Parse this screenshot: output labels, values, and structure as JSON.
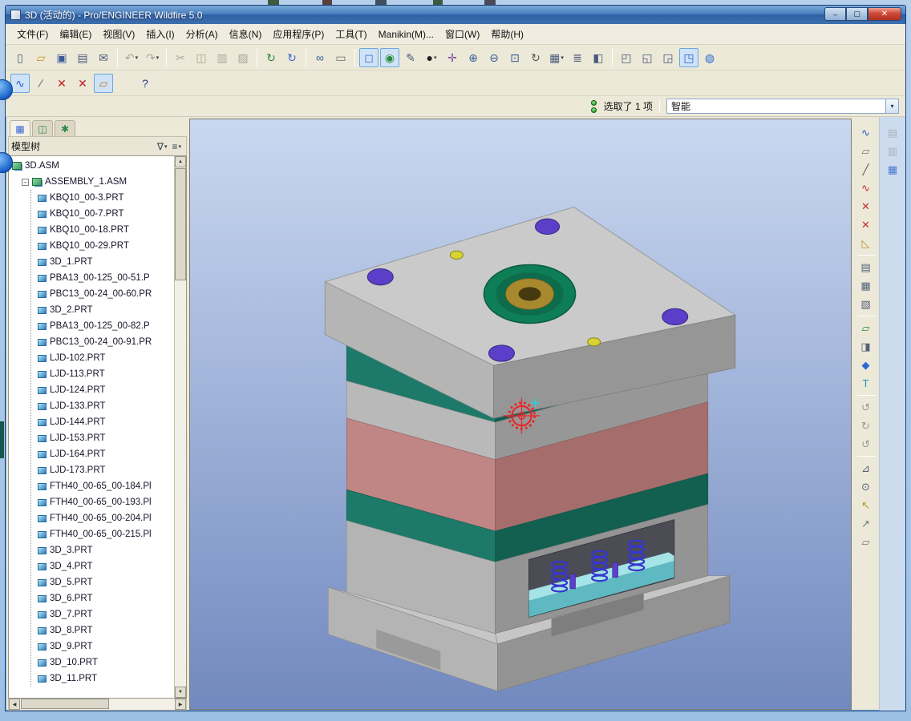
{
  "window": {
    "title": "3D (活动的) - Pro/ENGINEER Wildfire 5.0",
    "controls": {
      "minimize": "–",
      "maximize": "▢",
      "close": "✕"
    }
  },
  "menu": {
    "items": [
      "文件(F)",
      "编辑(E)",
      "视图(V)",
      "插入(I)",
      "分析(A)",
      "信息(N)",
      "应用程序(P)",
      "工具(T)",
      "Manikin(M)...",
      "窗口(W)",
      "帮助(H)"
    ]
  },
  "toolbar_main": {
    "items": [
      {
        "name": "new-file-icon",
        "glyph": "▯",
        "color": "#4a5a7a"
      },
      {
        "name": "open-folder-icon",
        "glyph": "▱",
        "color": "#c89018"
      },
      {
        "name": "save-icon",
        "glyph": "▣",
        "color": "#3a5a9a"
      },
      {
        "name": "print-icon",
        "glyph": "▤",
        "color": "#4a5a7a"
      },
      {
        "name": "send-mail-icon",
        "glyph": "✉",
        "color": "#4a5a7a"
      },
      {
        "sep": true
      },
      {
        "name": "undo-icon",
        "glyph": "↶",
        "color": "#9a968c",
        "disabled": true,
        "dropdown": true
      },
      {
        "name": "redo-icon",
        "glyph": "↷",
        "color": "#9a968c",
        "disabled": true,
        "dropdown": true
      },
      {
        "sep": true
      },
      {
        "name": "cut-icon",
        "glyph": "✂",
        "color": "#8a8680",
        "disabled": true
      },
      {
        "name": "copy-icon",
        "glyph": "◫",
        "color": "#8a8680",
        "disabled": true
      },
      {
        "name": "paste-icon",
        "glyph": "▥",
        "color": "#8a8680",
        "disabled": true
      },
      {
        "name": "paste-special-icon",
        "glyph": "▨",
        "color": "#8a8680",
        "disabled": true
      },
      {
        "sep": true
      },
      {
        "name": "regenerate-icon",
        "glyph": "↻",
        "color": "#2a8a3a"
      },
      {
        "name": "regenerate-manager-icon",
        "glyph": "↻",
        "color": "#3a6ad0"
      },
      {
        "sep": true
      },
      {
        "name": "find-icon",
        "glyph": "∞",
        "color": "#3a5a9a"
      },
      {
        "name": "select-rect-icon",
        "glyph": "▭",
        "color": "#6a6a6a"
      },
      {
        "sep": true
      },
      {
        "name": "select-inside-icon",
        "glyph": "◻",
        "color": "#3a6ad0",
        "active": true
      },
      {
        "name": "smart-select-icon",
        "glyph": "◉",
        "color": "#2a8a3a",
        "active": true
      },
      {
        "name": "annotate-icon",
        "glyph": "✎",
        "color": "#4a5a7a"
      },
      {
        "name": "shade-mode-icon",
        "glyph": "●",
        "color": "#222222",
        "dropdown": true
      },
      {
        "name": "spin-center-icon",
        "glyph": "✛",
        "color": "#8a4aa0"
      },
      {
        "name": "zoom-in-icon",
        "glyph": "⊕",
        "color": "#3a5a9a"
      },
      {
        "name": "zoom-out-icon",
        "glyph": "⊖",
        "color": "#3a5a9a"
      },
      {
        "name": "refit-icon",
        "glyph": "⊡",
        "color": "#3a5a9a"
      },
      {
        "name": "reorient-icon",
        "glyph": "↻",
        "color": "#555555"
      },
      {
        "name": "saved-views-icon",
        "glyph": "▦",
        "color": "#4a5a7a",
        "dropdown": true
      },
      {
        "name": "layers-icon",
        "glyph": "≣",
        "color": "#4a5a7a"
      },
      {
        "name": "view-manager-icon",
        "glyph": "◧",
        "color": "#4a5a7a"
      },
      {
        "sep": true
      },
      {
        "name": "window-tile-icon",
        "glyph": "◰",
        "color": "#4a5a7a"
      },
      {
        "name": "window-cascade-icon",
        "glyph": "◱",
        "color": "#4a5a7a"
      },
      {
        "name": "window-default-icon",
        "glyph": "◲",
        "color": "#4a5a7a"
      },
      {
        "name": "window-active-icon",
        "glyph": "◳",
        "color": "#2a5ad0",
        "active": true
      },
      {
        "name": "learning-center-icon",
        "glyph": "◍",
        "color": "#2a6ad4"
      }
    ]
  },
  "toolbar_second": {
    "items": [
      {
        "name": "sketch-tool-icon",
        "glyph": "∿",
        "color": "#2a5ad4",
        "active": true
      },
      {
        "name": "datum-axis-icon",
        "glyph": "∕",
        "color": "#555555"
      },
      {
        "name": "datum-point-icon",
        "glyph": "✕",
        "color": "#c22020"
      },
      {
        "name": "datum-points-icon",
        "glyph": "✕",
        "color": "#c22020"
      },
      {
        "name": "datum-plane-icon",
        "glyph": "▱",
        "color": "#c87818",
        "active": true
      },
      {
        "gap": 26
      },
      {
        "name": "context-help-icon",
        "glyph": "?",
        "color": "#2a3a8a"
      }
    ]
  },
  "status": {
    "selected_text": "选取了 1 项",
    "filter_value": "智能"
  },
  "model_tree": {
    "title": "模型树",
    "collapse_glyph": "−",
    "tabs": [
      {
        "name": "model-tree-tab",
        "glyph": "▦",
        "color": "#3a6ad4",
        "active": true
      },
      {
        "name": "folder-browser-tab",
        "glyph": "◫",
        "color": "#2a8a4a"
      },
      {
        "name": "favorites-tab",
        "glyph": "✱",
        "color": "#2a8a4a"
      }
    ],
    "header_buttons": [
      {
        "name": "tree-filters-icon",
        "glyph": "∇"
      },
      {
        "name": "tree-columns-icon",
        "glyph": "≡"
      }
    ],
    "root": "3D.ASM",
    "assembly": "ASSEMBLY_1.ASM",
    "items": [
      "KBQ10_00-3.PRT",
      "KBQ10_00-7.PRT",
      "KBQ10_00-18.PRT",
      "KBQ10_00-29.PRT",
      "3D_1.PRT",
      "PBA13_00-125_00-51.P",
      "PBC13_00-24_00-60.PR",
      "3D_2.PRT",
      "PBA13_00-125_00-82.P",
      "PBC13_00-24_00-91.PR",
      "LJD-102.PRT",
      "LJD-113.PRT",
      "LJD-124.PRT",
      "LJD-133.PRT",
      "LJD-144.PRT",
      "LJD-153.PRT",
      "LJD-164.PRT",
      "LJD-173.PRT",
      "FTH40_00-65_00-184.Pl",
      "FTH40_00-65_00-193.Pl",
      "FTH40_00-65_00-204.Pl",
      "FTH40_00-65_00-215.Pl",
      "3D_3.PRT",
      "3D_4.PRT",
      "3D_5.PRT",
      "3D_6.PRT",
      "3D_7.PRT",
      "3D_8.PRT",
      "3D_9.PRT",
      "3D_10.PRT",
      "3D_11.PRT"
    ]
  },
  "right_toolbar": {
    "items": [
      {
        "name": "graph-tool-icon",
        "glyph": "∿",
        "color": "#2a5ad4"
      },
      {
        "name": "rectangle-tool-icon",
        "glyph": "▱",
        "color": "#777777"
      },
      {
        "name": "line-tool-icon",
        "glyph": "╱",
        "color": "#555555"
      },
      {
        "name": "spline-tool-icon",
        "glyph": "∿",
        "color": "#c03030"
      },
      {
        "name": "point-tool-icon",
        "glyph": "✕",
        "color": "#c03030"
      },
      {
        "name": "points-tool-icon",
        "glyph": "✕",
        "color": "#c03030"
      },
      {
        "name": "offset-edge-icon",
        "glyph": "◺",
        "color": "#b8952a"
      },
      {
        "sep": true
      },
      {
        "name": "sketch-setup-icon",
        "glyph": "▤",
        "color": "#55607a"
      },
      {
        "name": "palette-icon",
        "glyph": "▦",
        "color": "#55607a"
      },
      {
        "name": "palette-copy-icon",
        "glyph": "▧",
        "color": "#55607a"
      },
      {
        "sep": true
      },
      {
        "name": "plane-display-icon",
        "glyph": "▱",
        "color": "#2a8a3a"
      },
      {
        "name": "sketch-view-icon",
        "glyph": "◨",
        "color": "#55607a"
      },
      {
        "name": "shade-loops-icon",
        "glyph": "◆",
        "color": "#2a6ad4"
      },
      {
        "name": "text-tool-icon",
        "glyph": "T",
        "color": "#1a98a8"
      },
      {
        "sep": true
      },
      {
        "name": "feature-tool-1-icon",
        "glyph": "↺",
        "color": "#999999"
      },
      {
        "name": "feature-tool-2-icon",
        "glyph": "↻",
        "color": "#999999"
      },
      {
        "name": "feature-tool-3-icon",
        "glyph": "↺",
        "color": "#999999"
      },
      {
        "sep": true
      },
      {
        "name": "analysis-tool-icon",
        "glyph": "⊿",
        "color": "#55607a"
      },
      {
        "name": "measure-tool-icon",
        "glyph": "⊙",
        "color": "#55607a"
      },
      {
        "name": "select-arrow-icon",
        "glyph": "↖",
        "color": "#b8952a"
      },
      {
        "name": "select-arrow-2-icon",
        "glyph": "↗",
        "color": "#777777"
      },
      {
        "name": "plane-tool-icon",
        "glyph": "▱",
        "color": "#777777"
      }
    ],
    "dim_items": [
      {
        "name": "model-player-icon",
        "glyph": "▤",
        "color": "#aab0bc"
      },
      {
        "name": "component-icon",
        "glyph": "▥",
        "color": "#aab0bc"
      },
      {
        "name": "grid-snap-icon",
        "glyph": "▦",
        "color": "#4a7ad0"
      }
    ]
  },
  "viewport": {
    "model_colors": {
      "top_plate": "#cacaca",
      "cavity_plate": "#1d7a68",
      "core_plate": "#b9b9b9",
      "spacer_plate": "#c08585",
      "support_plate": "#1d7a68",
      "base_plate": "#b4b4b4",
      "locating_ring": "#0e7e57",
      "ring_insert": "#a8892e",
      "guide_holes": "#5b3fc8",
      "screws": "#d8d232",
      "ejector_plate": "#a5e4e6",
      "springs": "#3636cf",
      "highlight_marker": "#ee2222",
      "background_top": "#c9d8f0",
      "background_bottom": "#7289bf"
    }
  }
}
